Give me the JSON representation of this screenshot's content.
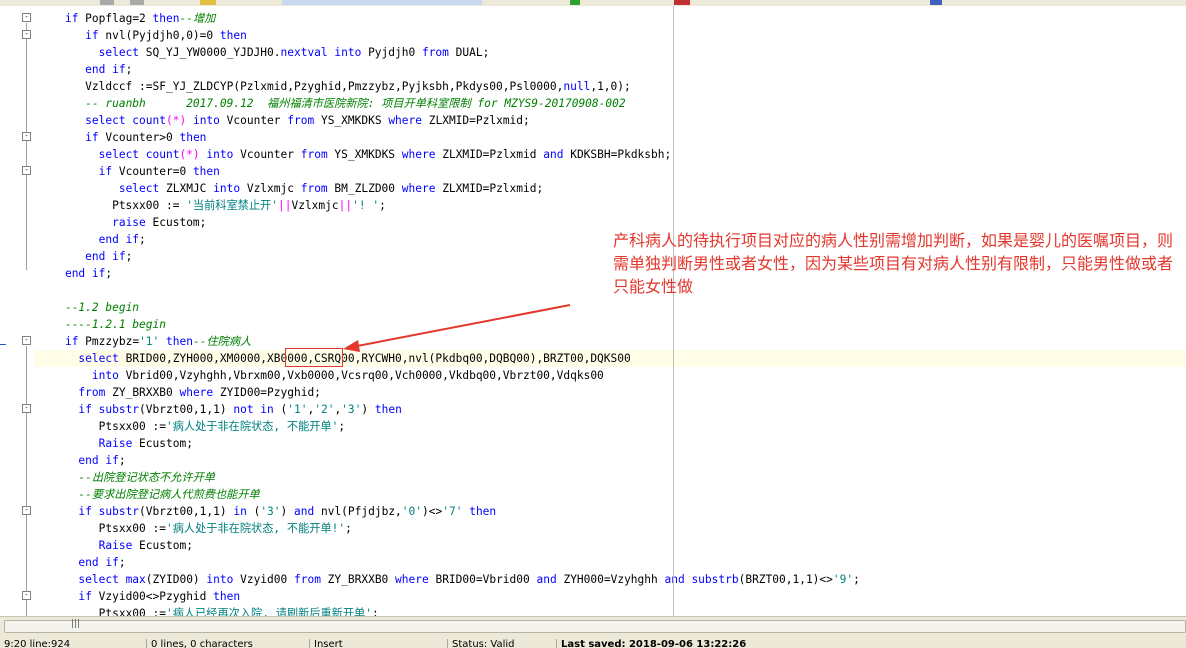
{
  "editor": {
    "lines": [
      [
        [
          "t",
          "    "
        ],
        [
          "k",
          "if "
        ],
        [
          "t",
          "Popflag=2 "
        ],
        [
          "k",
          "then"
        ],
        [
          "c",
          "--增加"
        ]
      ],
      [
        [
          "t",
          "       "
        ],
        [
          "k",
          "if "
        ],
        [
          "t",
          "nvl(Pyjdjh0,0)=0 "
        ],
        [
          "k",
          "then"
        ]
      ],
      [
        [
          "t",
          "         "
        ],
        [
          "k",
          "select "
        ],
        [
          "t",
          "SQ_YJ_YW0000_YJDJH0."
        ],
        [
          "k",
          "nextval into "
        ],
        [
          "t",
          "Pyjdjh0 "
        ],
        [
          "k",
          "from "
        ],
        [
          "t",
          "DUAL;"
        ]
      ],
      [
        [
          "t",
          "       "
        ],
        [
          "k",
          "end if"
        ],
        [
          "t",
          ";"
        ]
      ],
      [
        [
          "t",
          "       Vzldccf :=SF_YJ_ZLDCYP(Pzlxmid,Pzyghid,Pmzzybz,Pyjksbh,Pkdys00,Psl0000,"
        ],
        [
          "k",
          "null"
        ],
        [
          "t",
          ",1,0);"
        ]
      ],
      [
        [
          "t",
          "       "
        ],
        [
          "c",
          "-- ruanbh      2017.09.12  福州福清市医院新院: 项目开单科室限制 for MZYS9-20170908-002"
        ]
      ],
      [
        [
          "t",
          "       "
        ],
        [
          "k",
          "select count"
        ],
        [
          "f",
          "(*)"
        ],
        [
          "t",
          " "
        ],
        [
          "k",
          "into "
        ],
        [
          "t",
          "Vcounter "
        ],
        [
          "k",
          "from "
        ],
        [
          "t",
          "YS_XMKDKS "
        ],
        [
          "k",
          "where "
        ],
        [
          "t",
          "ZLXMID=Pzlxmid;"
        ]
      ],
      [
        [
          "t",
          "       "
        ],
        [
          "k",
          "if "
        ],
        [
          "t",
          "Vcounter>0 "
        ],
        [
          "k",
          "then"
        ]
      ],
      [
        [
          "t",
          "         "
        ],
        [
          "k",
          "select count"
        ],
        [
          "f",
          "(*)"
        ],
        [
          "t",
          " "
        ],
        [
          "k",
          "into "
        ],
        [
          "t",
          "Vcounter "
        ],
        [
          "k",
          "from "
        ],
        [
          "t",
          "YS_XMKDKS "
        ],
        [
          "k",
          "where "
        ],
        [
          "t",
          "ZLXMID=Pzlxmid "
        ],
        [
          "k",
          "and "
        ],
        [
          "t",
          "KDKSBH=Pkdksbh;"
        ]
      ],
      [
        [
          "t",
          "         "
        ],
        [
          "k",
          "if "
        ],
        [
          "t",
          "Vcounter=0 "
        ],
        [
          "k",
          "then"
        ]
      ],
      [
        [
          "t",
          "            "
        ],
        [
          "k",
          "select "
        ],
        [
          "t",
          "ZLXMJC "
        ],
        [
          "k",
          "into "
        ],
        [
          "t",
          "Vzlxmjc "
        ],
        [
          "k",
          "from "
        ],
        [
          "t",
          "BM_ZLZD00 "
        ],
        [
          "k",
          "where "
        ],
        [
          "t",
          "ZLXMID=Pzlxmid;"
        ]
      ],
      [
        [
          "t",
          "           Ptsxx00 := "
        ],
        [
          "s",
          "'当前科室禁止开'"
        ],
        [
          "f",
          "||"
        ],
        [
          "t",
          "Vzlxmjc"
        ],
        [
          "f",
          "||"
        ],
        [
          "s",
          "'! '"
        ],
        [
          "t",
          ";"
        ]
      ],
      [
        [
          "t",
          "           "
        ],
        [
          "k",
          "raise "
        ],
        [
          "t",
          "Ecustom;"
        ]
      ],
      [
        [
          "t",
          "         "
        ],
        [
          "k",
          "end if"
        ],
        [
          "t",
          ";"
        ]
      ],
      [
        [
          "t",
          "       "
        ],
        [
          "k",
          "end if"
        ],
        [
          "t",
          ";"
        ]
      ],
      [
        [
          "t",
          "    "
        ],
        [
          "k",
          "end if"
        ],
        [
          "t",
          ";"
        ]
      ],
      [
        [
          "t",
          ""
        ]
      ],
      [
        [
          "t",
          "    "
        ],
        [
          "c",
          "--1.2 begin"
        ]
      ],
      [
        [
          "t",
          "    "
        ],
        [
          "c",
          "----1.2.1 begin"
        ]
      ],
      [
        [
          "t",
          "    "
        ],
        [
          "k",
          "if "
        ],
        [
          "t",
          "Pmzzybz="
        ],
        [
          "s",
          "'1'"
        ],
        [
          "t",
          " "
        ],
        [
          "k",
          "then"
        ],
        [
          "c",
          "--住院病人"
        ]
      ],
      [
        [
          "t",
          "      "
        ],
        [
          "k",
          "select "
        ],
        [
          "t",
          "BRID00,ZYH000,XM0000,XB0000,CSRQ00,RYCWH0,nvl(Pkdbq00,DQBQ00),BRZT00,DQKS00"
        ]
      ],
      [
        [
          "t",
          "        "
        ],
        [
          "k",
          "into "
        ],
        [
          "t",
          "Vbrid00,Vzyhghh,Vbrxm00,Vxb0000,Vcsrq00,Vch0000,Vkdbq00,Vbrzt00,Vdqks00"
        ]
      ],
      [
        [
          "t",
          "      "
        ],
        [
          "k",
          "from "
        ],
        [
          "t",
          "ZY_BRXXB0 "
        ],
        [
          "k",
          "where "
        ],
        [
          "t",
          "ZYID00=Pzyghid;"
        ]
      ],
      [
        [
          "t",
          "      "
        ],
        [
          "k",
          "if substr"
        ],
        [
          "t",
          "(Vbrzt00,1,1) "
        ],
        [
          "k",
          "not in "
        ],
        [
          "t",
          "("
        ],
        [
          "s",
          "'1'"
        ],
        [
          "t",
          ","
        ],
        [
          "s",
          "'2'"
        ],
        [
          "t",
          ","
        ],
        [
          "s",
          "'3'"
        ],
        [
          "t",
          ") "
        ],
        [
          "k",
          "then"
        ]
      ],
      [
        [
          "t",
          "         Ptsxx00 :="
        ],
        [
          "s",
          "'病人处于非在院状态, 不能开单'"
        ],
        [
          "t",
          ";"
        ]
      ],
      [
        [
          "t",
          "         "
        ],
        [
          "k",
          "Raise "
        ],
        [
          "t",
          "Ecustom;"
        ]
      ],
      [
        [
          "t",
          "      "
        ],
        [
          "k",
          "end if"
        ],
        [
          "t",
          ";"
        ]
      ],
      [
        [
          "t",
          "      "
        ],
        [
          "c",
          "--出院登记状态不允许开单"
        ]
      ],
      [
        [
          "t",
          "      "
        ],
        [
          "c",
          "--要求出院登记病人代煎费也能开单"
        ]
      ],
      [
        [
          "t",
          "      "
        ],
        [
          "k",
          "if substr"
        ],
        [
          "t",
          "(Vbrzt00,1,1) "
        ],
        [
          "k",
          "in "
        ],
        [
          "t",
          "("
        ],
        [
          "s",
          "'3'"
        ],
        [
          "t",
          ") "
        ],
        [
          "k",
          "and "
        ],
        [
          "t",
          "nvl(Pfjdjbz,"
        ],
        [
          "s",
          "'0'"
        ],
        [
          "t",
          ")<>"
        ],
        [
          "s",
          "'7'"
        ],
        [
          "t",
          " "
        ],
        [
          "k",
          "then"
        ]
      ],
      [
        [
          "t",
          "         Ptsxx00 :="
        ],
        [
          "s",
          "'病人处于非在院状态, 不能开单!'"
        ],
        [
          "t",
          ";"
        ]
      ],
      [
        [
          "t",
          "         "
        ],
        [
          "k",
          "Raise "
        ],
        [
          "t",
          "Ecustom;"
        ]
      ],
      [
        [
          "t",
          "      "
        ],
        [
          "k",
          "end if"
        ],
        [
          "t",
          ";"
        ]
      ],
      [
        [
          "t",
          "      "
        ],
        [
          "k",
          "select max"
        ],
        [
          "t",
          "(ZYID00) "
        ],
        [
          "k",
          "into "
        ],
        [
          "t",
          "Vzyid00 "
        ],
        [
          "k",
          "from "
        ],
        [
          "t",
          "ZY_BRXXB0 "
        ],
        [
          "k",
          "where "
        ],
        [
          "t",
          "BRID00=Vbrid00 "
        ],
        [
          "k",
          "and "
        ],
        [
          "t",
          "ZYH000=Vzyhghh "
        ],
        [
          "k",
          "and substrb"
        ],
        [
          "t",
          "(BRZT00,1,1)<>"
        ],
        [
          "s",
          "'9'"
        ],
        [
          "t",
          ";"
        ]
      ],
      [
        [
          "t",
          "      "
        ],
        [
          "k",
          "if "
        ],
        [
          "t",
          "Vzyid00<>Pzyghid "
        ],
        [
          "k",
          "then"
        ]
      ],
      [
        [
          "t",
          "         Ptsxx00 :="
        ],
        [
          "s",
          "'病人已经再次入院, 请刷新后重新开单'"
        ],
        [
          "t",
          ";"
        ]
      ]
    ],
    "current_line_index": 20
  },
  "annotation": {
    "text": "产科病人的待执行项目对应的病人性别需增加判断，如果是婴儿的医嘱项目，则需单独判断男性或者女性，因为某些项目有对病人性别有限制，只能男性做或者只能女性做",
    "color": "#e3372c"
  },
  "hscroll": {
    "grip": "|||"
  },
  "statusbar": {
    "position": "9:20 line:924",
    "selection": "0 lines, 0 characters",
    "mode": "Insert",
    "status": "Status: Valid",
    "saved": "Last saved: 2018-09-06 13:22:26"
  },
  "colors": {
    "keyword": "#0000ff",
    "comment": "#008000",
    "string": "#008080",
    "operator": "#ff00ff",
    "annotation": "#e3372c"
  }
}
